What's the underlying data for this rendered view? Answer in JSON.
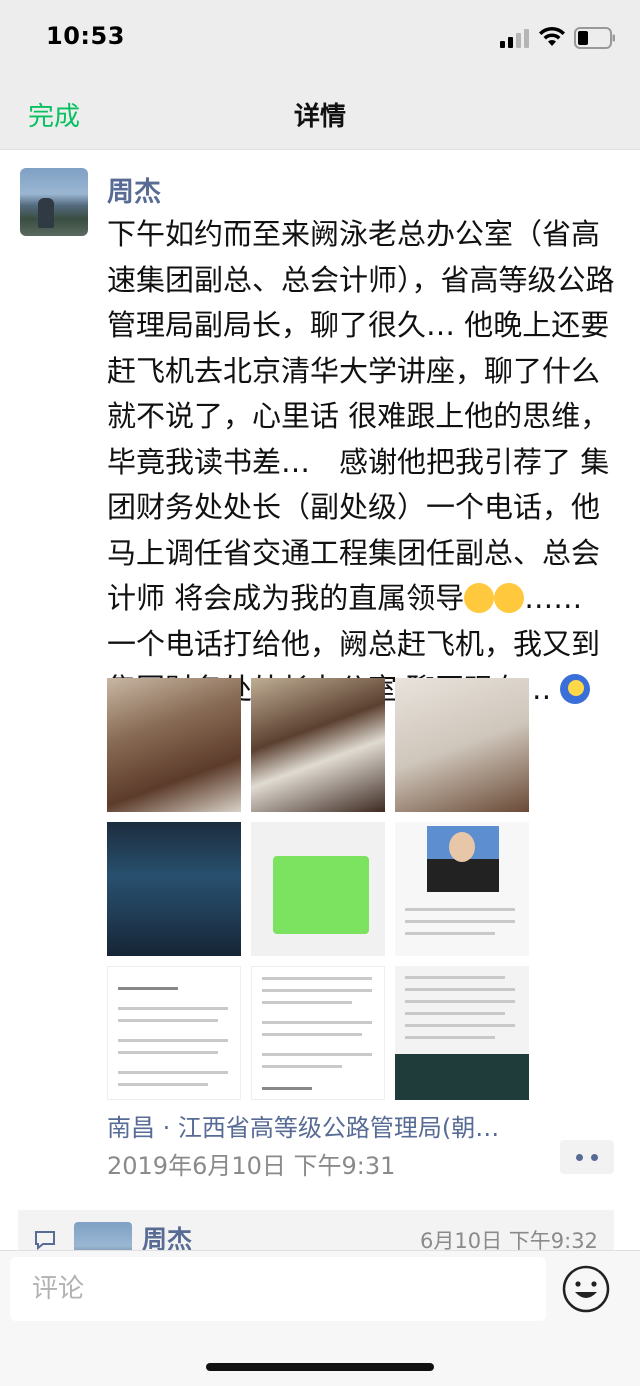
{
  "status_bar": {
    "time": "10:53"
  },
  "nav": {
    "done_label": "完成",
    "title": "详情"
  },
  "post": {
    "author": "周杰",
    "text_before_emoji": "下午如约而至来阙泳老总办公室（省高速集团副总、总会计师），省高等级公路管理局副局长，聊了很久… 他晚上还要赶飞机去北京清华大学讲座，聊了什么就不说了，心里话 很难跟上他的思维，毕竟我读书差…　感谢他把我引荐了 集团财务处处长（副处级）一个电话，他马上调任省交通工程集团任副总、总会计师 将会成为我的直属领导",
    "text_after_emoji": "…… 一个电话打给他，阙总赶飞机，我又到集团财务处处长办公室 聊至现在… ",
    "photos": [
      "office-desk-photo",
      "office-documents-photo",
      "document-closeup-photo",
      "company-directory-photo",
      "chat-screenshot-photo",
      "profile-photo",
      "resume-page-photo",
      "career-history-photo",
      "work-division-photo"
    ],
    "location": "南昌 · 江西省高等级公路管理局(朝…",
    "timestamp": "2019年6月10日 下午9:31"
  },
  "comment": {
    "author": "周杰",
    "time": "6月10日 下午9:32"
  },
  "input": {
    "placeholder": "评论"
  },
  "colors": {
    "accent_green": "#07c160",
    "link_blue": "#576b95"
  }
}
